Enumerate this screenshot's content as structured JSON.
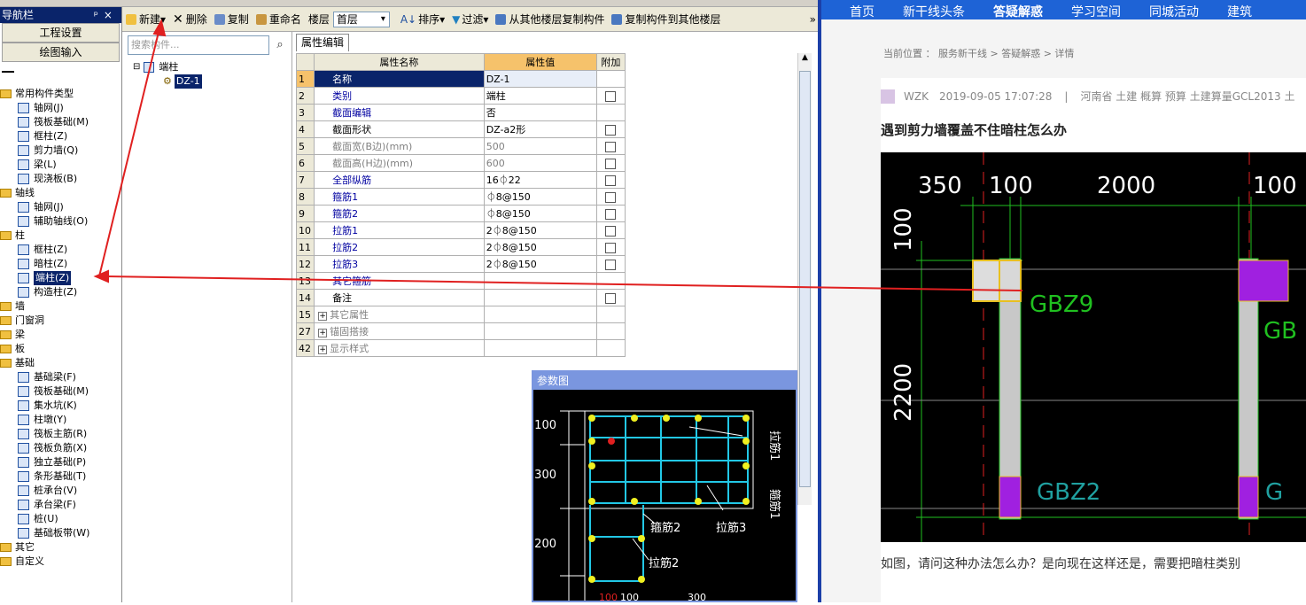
{
  "nav": {
    "title": "导航栏",
    "controls": "ᵖ×",
    "buttons": [
      "工程设置",
      "绘图输入"
    ],
    "tree": [
      {
        "label": "常用构件类型",
        "level": 0,
        "folder": true
      },
      {
        "label": "轴网(J)",
        "level": 1
      },
      {
        "label": "筏板基础(M)",
        "level": 1
      },
      {
        "label": "框柱(Z)",
        "level": 1
      },
      {
        "label": "剪力墙(Q)",
        "level": 1
      },
      {
        "label": "梁(L)",
        "level": 1
      },
      {
        "label": "现浇板(B)",
        "level": 1
      },
      {
        "label": "轴线",
        "level": 0,
        "folder": true
      },
      {
        "label": "轴网(J)",
        "level": 1
      },
      {
        "label": "辅助轴线(O)",
        "level": 1
      },
      {
        "label": "柱",
        "level": 0,
        "folder": true
      },
      {
        "label": "框柱(Z)",
        "level": 1
      },
      {
        "label": "暗柱(Z)",
        "level": 1
      },
      {
        "label": "端柱(Z)",
        "level": 1,
        "selected": true
      },
      {
        "label": "构造柱(Z)",
        "level": 1
      },
      {
        "label": "墙",
        "level": 0,
        "folder": true
      },
      {
        "label": "门窗洞",
        "level": 0,
        "folder": true
      },
      {
        "label": "梁",
        "level": 0,
        "folder": true
      },
      {
        "label": "板",
        "level": 0,
        "folder": true
      },
      {
        "label": "基础",
        "level": 0,
        "folder": true
      },
      {
        "label": "基础梁(F)",
        "level": 1
      },
      {
        "label": "筏板基础(M)",
        "level": 1
      },
      {
        "label": "集水坑(K)",
        "level": 1
      },
      {
        "label": "柱墩(Y)",
        "level": 1
      },
      {
        "label": "筏板主筋(R)",
        "level": 1
      },
      {
        "label": "筏板负筋(X)",
        "level": 1
      },
      {
        "label": "独立基础(P)",
        "level": 1
      },
      {
        "label": "条形基础(T)",
        "level": 1
      },
      {
        "label": "桩承台(V)",
        "level": 1
      },
      {
        "label": "承台梁(F)",
        "level": 1
      },
      {
        "label": "桩(U)",
        "level": 1
      },
      {
        "label": "基础板带(W)",
        "level": 1
      },
      {
        "label": "其它",
        "level": 0,
        "folder": true
      },
      {
        "label": "自定义",
        "level": 0,
        "folder": true
      }
    ]
  },
  "toolbar": {
    "new": "新建",
    "delete": "删除",
    "copy": "复制",
    "rename": "重命名",
    "floor_label": "楼层",
    "floor_value": "首层",
    "sort": "排序",
    "filter": "过滤",
    "copy_from": "从其他楼层复制构件",
    "copy_to": "复制构件到其他楼层",
    "more": "»"
  },
  "components": {
    "search_placeholder": "搜索构件...",
    "root": "端柱",
    "child": "DZ-1"
  },
  "props": {
    "tab": "属性编辑",
    "headers": [
      "属性名称",
      "属性值",
      "附加"
    ],
    "rows": [
      {
        "num": "1",
        "name": "名称",
        "value": "DZ-1",
        "style": "blue",
        "check": false
      },
      {
        "num": "2",
        "name": "类别",
        "value": "端柱",
        "style": "blue",
        "check": true
      },
      {
        "num": "3",
        "name": "截面编辑",
        "value": "否",
        "style": "blue",
        "check": false
      },
      {
        "num": "4",
        "name": "截面形状",
        "value": "DZ-a2形",
        "style": "normal",
        "check": true
      },
      {
        "num": "5",
        "name": "截面宽(B边)(mm)",
        "value": "500",
        "style": "gray",
        "check": true
      },
      {
        "num": "6",
        "name": "截面高(H边)(mm)",
        "value": "600",
        "style": "gray",
        "check": true
      },
      {
        "num": "7",
        "name": "全部纵筋",
        "value": "16⏀22",
        "style": "blue",
        "check": true
      },
      {
        "num": "8",
        "name": "箍筋1",
        "value": "⏀8@150",
        "style": "blue",
        "check": true
      },
      {
        "num": "9",
        "name": "箍筋2",
        "value": "⏀8@150",
        "style": "blue",
        "check": true
      },
      {
        "num": "10",
        "name": "拉筋1",
        "value": "2⏀8@150",
        "style": "blue",
        "check": true
      },
      {
        "num": "11",
        "name": "拉筋2",
        "value": "2⏀8@150",
        "style": "blue",
        "check": true
      },
      {
        "num": "12",
        "name": "拉筋3",
        "value": "2⏀8@150",
        "style": "blue",
        "check": true
      },
      {
        "num": "13",
        "name": "其它箍筋",
        "value": "",
        "style": "blue",
        "check": false
      },
      {
        "num": "14",
        "name": "备注",
        "value": "",
        "style": "normal",
        "check": true
      },
      {
        "num": "15",
        "name": "其它属性",
        "value": "",
        "style": "group",
        "check": false
      },
      {
        "num": "27",
        "name": "锚固搭接",
        "value": "",
        "style": "group",
        "check": false
      },
      {
        "num": "42",
        "name": "显示样式",
        "value": "",
        "style": "group",
        "check": false
      }
    ]
  },
  "diagram": {
    "title": "参数图",
    "dims_left": [
      "100",
      "300",
      "200"
    ],
    "dims_bottom": [
      "100",
      "100",
      "300"
    ],
    "labels": [
      "拉筋1",
      "箍筋1",
      "箍筋2",
      "拉筋3",
      "拉筋2"
    ]
  },
  "web": {
    "nav": [
      "首页",
      "新干线头条",
      "答疑解惑",
      "学习空间",
      "同城活动",
      "建筑"
    ],
    "active_nav": "答疑解惑",
    "breadcrumb": "当前位置 ： 服务新干线 > 答疑解惑 > 详情",
    "author": "WZK",
    "date": "2019-09-05 17:07:28",
    "sep": "|",
    "tags": "河南省  土建 概算 预算 土建算量GCL2013 土",
    "question_title": "遇到剪力墙覆盖不住暗柱怎么办",
    "cad_dims_top": [
      "350",
      "100",
      "2000",
      "100"
    ],
    "cad_dims_left": [
      "100",
      "2200"
    ],
    "cad_labels": [
      "GBZ9",
      "GBZ2",
      "GB",
      "G"
    ],
    "description": "如图，请问这种办法怎么办？是向现在这样还是，需要把暗柱类别"
  }
}
